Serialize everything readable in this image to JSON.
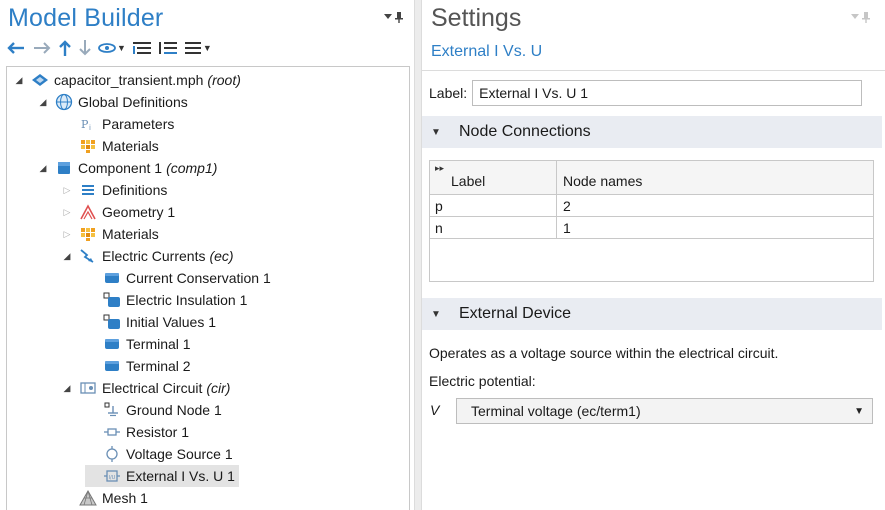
{
  "model_builder": {
    "title": "Model Builder",
    "pin_glyph": "▾ ⊥",
    "toolbar": [
      "back-arrow-icon",
      "forward-arrow-icon",
      "up-arrow-icon",
      "down-arrow-icon",
      "show-options-icon",
      "expand-sections-icon",
      "collapse-sections-icon",
      "list-view-icon"
    ],
    "tree": [
      {
        "label": "capacitor_transient.mph",
        "tag": "(root)",
        "icon": "root-model-icon",
        "level": 0,
        "exp": "open"
      },
      {
        "label": "Global Definitions",
        "tag": "",
        "icon": "globe-icon",
        "level": 1,
        "exp": "open"
      },
      {
        "label": "Parameters",
        "tag": "",
        "icon": "parameters-icon",
        "level": 2,
        "exp": "none"
      },
      {
        "label": "Materials",
        "tag": "",
        "icon": "materials-icon",
        "level": 2,
        "exp": "none"
      },
      {
        "label": "Component 1",
        "tag": "(comp1)",
        "icon": "component-icon",
        "level": 1,
        "exp": "open"
      },
      {
        "label": "Definitions",
        "tag": "",
        "icon": "definitions-icon",
        "level": 2,
        "exp": "closed"
      },
      {
        "label": "Geometry 1",
        "tag": "",
        "icon": "geometry-icon",
        "level": 2,
        "exp": "closed"
      },
      {
        "label": "Materials",
        "tag": "",
        "icon": "materials-icon",
        "level": 2,
        "exp": "closed"
      },
      {
        "label": "Electric Currents",
        "tag": "(ec)",
        "icon": "electric-currents-icon",
        "level": 2,
        "exp": "open"
      },
      {
        "label": "Current Conservation 1",
        "tag": "",
        "icon": "domain-feature-icon",
        "level": 3,
        "exp": "none"
      },
      {
        "label": "Electric Insulation 1",
        "tag": "",
        "icon": "boundary-feature-icon",
        "level": 3,
        "exp": "none"
      },
      {
        "label": "Initial Values 1",
        "tag": "",
        "icon": "boundary-feature-icon",
        "level": 3,
        "exp": "none"
      },
      {
        "label": "Terminal 1",
        "tag": "",
        "icon": "domain-feature-icon",
        "level": 3,
        "exp": "none"
      },
      {
        "label": "Terminal 2",
        "tag": "",
        "icon": "domain-feature-icon",
        "level": 3,
        "exp": "none"
      },
      {
        "label": "Electrical Circuit",
        "tag": "(cir)",
        "icon": "electrical-circuit-icon",
        "level": 2,
        "exp": "open"
      },
      {
        "label": "Ground Node 1",
        "tag": "",
        "icon": "ground-node-icon",
        "level": 3,
        "exp": "none"
      },
      {
        "label": "Resistor 1",
        "tag": "",
        "icon": "resistor-icon",
        "level": 3,
        "exp": "none"
      },
      {
        "label": "Voltage Source 1",
        "tag": "",
        "icon": "voltage-source-icon",
        "level": 3,
        "exp": "none"
      },
      {
        "label": "External I Vs. U 1",
        "tag": "",
        "icon": "external-iu-icon",
        "level": 3,
        "exp": "none",
        "selected": true
      },
      {
        "label": "Mesh 1",
        "tag": "",
        "icon": "mesh-icon",
        "level": 2,
        "exp": "none"
      }
    ]
  },
  "settings": {
    "title": "Settings",
    "subtitle": "External I Vs. U",
    "label_key": "Label:",
    "label_value": "External I Vs. U 1",
    "node_connections": {
      "title": "Node Connections",
      "header_label": "Label",
      "header_nodes": "Node names",
      "expand_glyph": "▸▸",
      "rows": [
        {
          "label": "p",
          "node": "2"
        },
        {
          "label": "n",
          "node": "1"
        }
      ]
    },
    "external_device": {
      "title": "External Device",
      "description": "Operates as a voltage source within the electrical circuit.",
      "potential_label": "Electric potential:",
      "symbol": "V",
      "selected": "Terminal voltage (ec/term1)"
    }
  },
  "colors": {
    "accent": "#2e7fc6",
    "section_bg": "#e9ecf2",
    "selection_bg": "#e3e3e3"
  }
}
